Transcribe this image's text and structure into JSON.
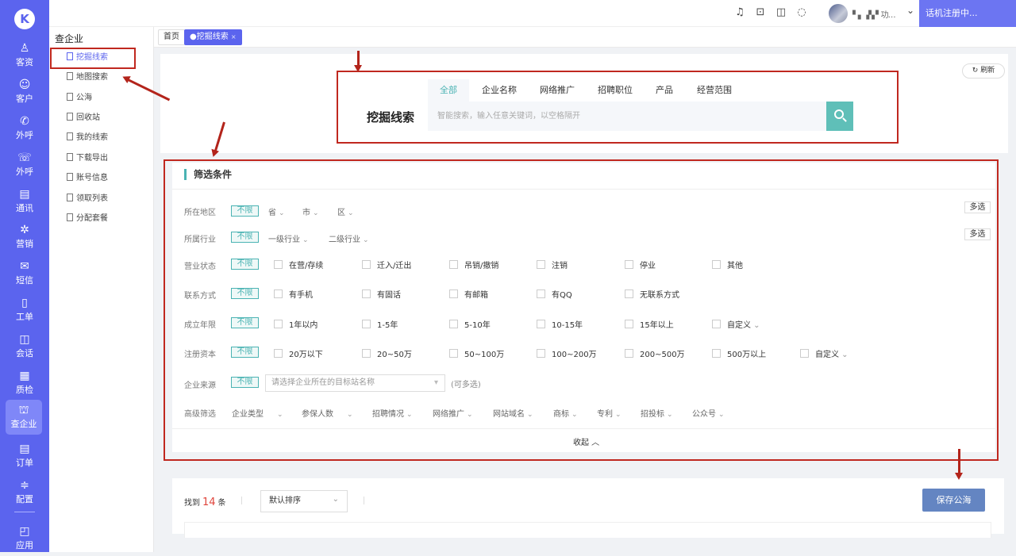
{
  "leftnav": {
    "logo": "K",
    "items": [
      {
        "label": "客资",
        "icon": "users-icon",
        "glyph": "♙"
      },
      {
        "label": "客户",
        "icon": "person-icon",
        "glyph": "☺"
      },
      {
        "label": "外呼",
        "icon": "phone-out-icon",
        "glyph": "✆"
      },
      {
        "label": "外呼",
        "icon": "phone-forward-icon",
        "glyph": "☏"
      },
      {
        "label": "通讯",
        "icon": "contacts-icon",
        "glyph": "▤"
      },
      {
        "label": "营销",
        "icon": "gear-icon",
        "glyph": "✲"
      },
      {
        "label": "短信",
        "icon": "message-icon",
        "glyph": "✉"
      },
      {
        "label": "工单",
        "icon": "clipboard-icon",
        "glyph": "▯"
      },
      {
        "label": "会话",
        "icon": "chat-icon",
        "glyph": "◫"
      },
      {
        "label": "质检",
        "icon": "inspect-icon",
        "glyph": "▦"
      },
      {
        "label": "查企业",
        "icon": "building-icon",
        "glyph": "⛫"
      },
      {
        "label": "订单",
        "icon": "order-icon",
        "glyph": "▤"
      },
      {
        "label": "配置",
        "icon": "sliders-icon",
        "glyph": "≑"
      },
      {
        "label": "应用",
        "icon": "app-icon",
        "glyph": "◰"
      }
    ]
  },
  "subnav": {
    "title": "查企业",
    "items": [
      "挖掘线索",
      "地图搜索",
      "公海",
      "回收站",
      "我的线索",
      "下载导出",
      "账号信息",
      "领取列表",
      "分配套餐"
    ]
  },
  "topbar": {
    "icons": [
      {
        "name": "headset-icon",
        "glyph": "♫"
      },
      {
        "name": "monitor-icon",
        "glyph": "⊡"
      },
      {
        "name": "book-icon",
        "glyph": "◫"
      },
      {
        "name": "chat-bubble-icon",
        "glyph": "◌"
      }
    ],
    "user_name": "▘▖▗▚ ▘功…",
    "status": "话机注册中..."
  },
  "tabs": [
    {
      "label": "首页"
    },
    {
      "label": "●挖掘线索",
      "close": "×"
    }
  ],
  "search": {
    "title": "挖掘线索",
    "refresh": "刷新",
    "tabs": [
      "全部",
      "企业名称",
      "网络推广",
      "招聘职位",
      "产品",
      "经营范围"
    ],
    "placeholder": "智能搜索，输入任意关键词，以空格隔开"
  },
  "filter": {
    "title": "筛选条件",
    "unlimited": "不限",
    "multi": "多选",
    "region": {
      "label": "所在地区",
      "dropdowns": [
        "省",
        "市",
        "区"
      ]
    },
    "industry": {
      "label": "所属行业",
      "dropdowns": [
        "一级行业",
        "二级行业"
      ]
    },
    "status": {
      "label": "营业状态",
      "options": [
        "在营/存续",
        "迁入/迁出",
        "吊销/撤销",
        "注销",
        "停业",
        "其他"
      ]
    },
    "contact": {
      "label": "联系方式",
      "options": [
        "有手机",
        "有固话",
        "有邮箱",
        "有QQ",
        "无联系方式"
      ]
    },
    "years": {
      "label": "成立年限",
      "options": [
        "1年以内",
        "1-5年",
        "5-10年",
        "10-15年",
        "15年以上"
      ],
      "custom": "自定义"
    },
    "capital": {
      "label": "注册资本",
      "options": [
        "20万以下",
        "20~50万",
        "50~100万",
        "100~200万",
        "200~500万",
        "500万以上"
      ],
      "custom": "自定义"
    },
    "source": {
      "label": "企业来源",
      "placeholder": "请选择企业所在的目标站名称",
      "hint": "(可多选)"
    },
    "advanced": {
      "label": "高级筛选",
      "dropdowns": [
        "企业类型",
        "参保人数",
        "招聘情况",
        "网络推广",
        "网站域名",
        "商标",
        "专利",
        "招投标",
        "公众号"
      ]
    },
    "collapse": "收起 ︿"
  },
  "result": {
    "found_prefix": "找到",
    "count": "14",
    "found_suffix": "条",
    "sort": "默认排序",
    "save": "保存公海"
  },
  "colors": {
    "primary": "#5b64ee",
    "teal": "#4ab3b3",
    "annotation": "#c0281f",
    "save_button": "#6485c2"
  }
}
